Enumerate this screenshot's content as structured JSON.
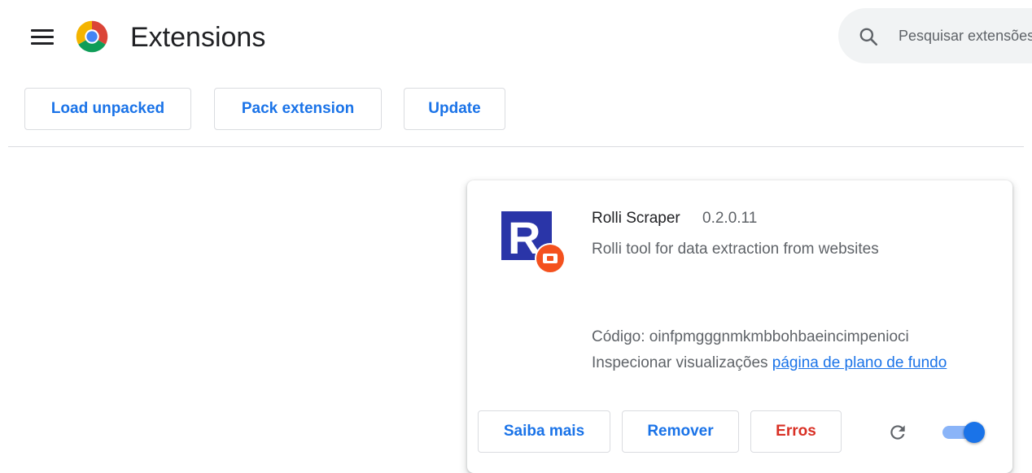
{
  "header": {
    "title": "Extensions",
    "search_placeholder": "Pesquisar extensões"
  },
  "toolbar": {
    "load_unpacked": "Load unpacked",
    "pack_extension": "Pack extension",
    "update": "Update"
  },
  "extension": {
    "name": "Rolli Scraper",
    "version": "0.2.0.11",
    "description": "Rolli tool for data extraction from websites",
    "id_label": "Código: oinfpmgggnmkmbbohbaeincimpenioci",
    "inspect_label": "Inspecionar visualizações",
    "inspect_link": "página de plano de fundo",
    "buttons": {
      "details": "Saiba mais",
      "remove": "Remover",
      "errors": "Erros"
    },
    "enabled": true
  },
  "colors": {
    "accent": "#1a73e8",
    "error": "#d93025",
    "icon_navy": "#2a35a8",
    "icon_badge": "#f4511e"
  }
}
